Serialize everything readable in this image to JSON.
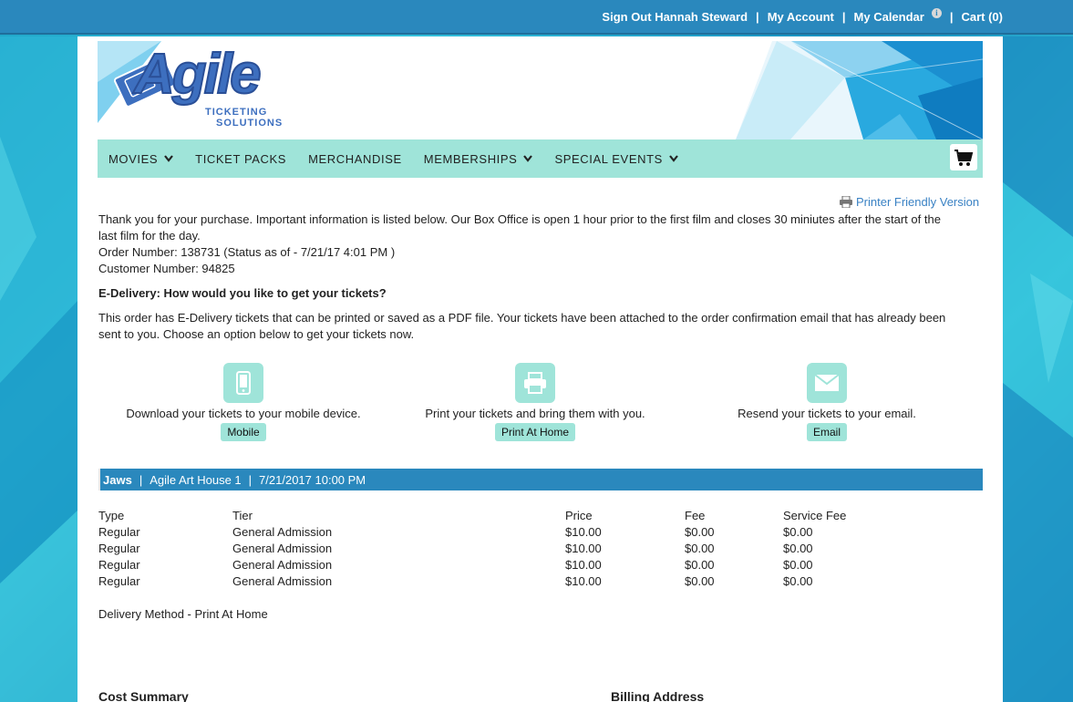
{
  "topbar": {
    "sign_out": "Sign Out Hannah Steward",
    "my_account": "My Account",
    "my_calendar": "My Calendar",
    "cart": "Cart (0)",
    "separator": "|"
  },
  "logo": {
    "name": "Agile",
    "line1": "TICKETING",
    "line2": "SOLUTIONS"
  },
  "nav": {
    "items": [
      {
        "label": "MOVIES",
        "dropdown": true
      },
      {
        "label": "TICKET PACKS",
        "dropdown": false
      },
      {
        "label": "MERCHANDISE",
        "dropdown": false
      },
      {
        "label": "MEMBERSHIPS",
        "dropdown": true
      },
      {
        "label": "SPECIAL EVENTS",
        "dropdown": true
      }
    ],
    "cart_icon": "shopping-cart-icon"
  },
  "printer_link": "Printer Friendly Version",
  "intro": {
    "thank_you_1": "Thank you for your purchase. Important information is listed below. Our Box Office is open 1 hour prior to the first film and closes 30 miniutes after the start of the",
    "thank_you_2": "last film for the day.",
    "order_number": "Order Number: 138731 (Status as of - 7/21/17 4:01 PM )",
    "customer_number": "Customer Number: 94825"
  },
  "edelivery": {
    "heading": "E-Delivery: How would you like to get your tickets?",
    "desc_1": "This order has E-Delivery tickets that can be printed or saved as a PDF file.  Your tickets have been attached to the order confirmation email that has already been",
    "desc_2": "sent to you.  Choose an option below to get your tickets now.",
    "options": [
      {
        "icon": "mobile-phone-icon",
        "text": "Download your tickets to your mobile device.",
        "button": "Mobile"
      },
      {
        "icon": "printer-icon",
        "text": "Print your tickets and bring them with you.",
        "button": "Print At Home"
      },
      {
        "icon": "envelope-icon",
        "text": "Resend your tickets to your email.",
        "button": "Email"
      }
    ]
  },
  "event": {
    "title": "Jaws",
    "venue": "Agile Art House 1",
    "datetime": "7/21/2017 10:00 PM",
    "separator": "|"
  },
  "tickets": {
    "headers": [
      "Type",
      "Tier",
      "Price",
      "Fee",
      "Service Fee"
    ],
    "rows": [
      [
        "Regular",
        "General Admission",
        "$10.00",
        "$0.00",
        "$0.00"
      ],
      [
        "Regular",
        "General Admission",
        "$10.00",
        "$0.00",
        "$0.00"
      ],
      [
        "Regular",
        "General Admission",
        "$10.00",
        "$0.00",
        "$0.00"
      ],
      [
        "Regular",
        "General Admission",
        "$10.00",
        "$0.00",
        "$0.00"
      ]
    ]
  },
  "delivery_method": "Delivery Method - Print At Home",
  "sections": {
    "cost_summary": "Cost Summary",
    "billing_address": "Billing Address"
  },
  "colors": {
    "topbar": "#2a88bd",
    "nav": "#9fe4d9",
    "link": "#3a82c4",
    "event_bar": "#2a88bd"
  }
}
